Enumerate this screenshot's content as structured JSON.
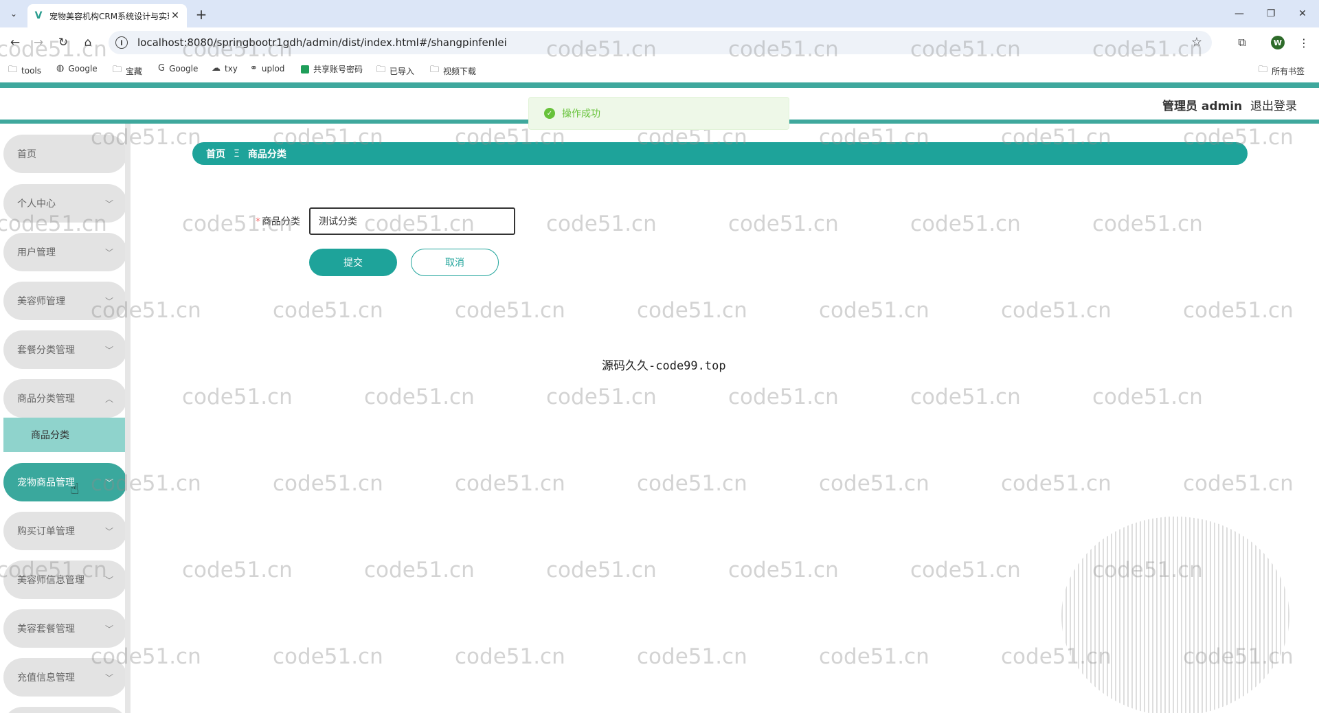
{
  "browser": {
    "tab_title": "宠物美容机构CRM系统设计与实现",
    "url": "localhost:8080/springbootr1gdh/admin/dist/index.html#/shangpinfenlei",
    "profile_initial": "W",
    "bookmarks": [
      "tools",
      "Google",
      "宝藏",
      "Google",
      "txy",
      "uplod",
      "共享账号密码",
      "已导入",
      "视频下载"
    ],
    "all_bookmarks": "所有书签"
  },
  "header": {
    "user_label": "管理员 admin",
    "logout_label": "退出登录"
  },
  "toast": {
    "message": "操作成功"
  },
  "sidebar": {
    "items": [
      {
        "label": "首页"
      },
      {
        "label": "个人中心"
      },
      {
        "label": "用户管理"
      },
      {
        "label": "美容师管理"
      },
      {
        "label": "套餐分类管理"
      },
      {
        "label": "商品分类管理"
      },
      {
        "label": "宠物商品管理"
      },
      {
        "label": "购买订单管理"
      },
      {
        "label": "美容师信息管理"
      },
      {
        "label": "美容套餐管理"
      },
      {
        "label": "充值信息管理"
      }
    ],
    "subitem": "商品分类"
  },
  "breadcrumb": {
    "home": "首页",
    "separator": "Ξ",
    "current": "商品分类"
  },
  "form": {
    "label": "商品分类",
    "value": "测试分类",
    "submit_label": "提交",
    "cancel_label": "取消"
  },
  "footer_text": "源码久久-code99.top",
  "watermark_text": "code51.cn",
  "colors": {
    "primary": "#1ea39a",
    "submenu": "#8fd3cc",
    "success": "#67c23a"
  }
}
